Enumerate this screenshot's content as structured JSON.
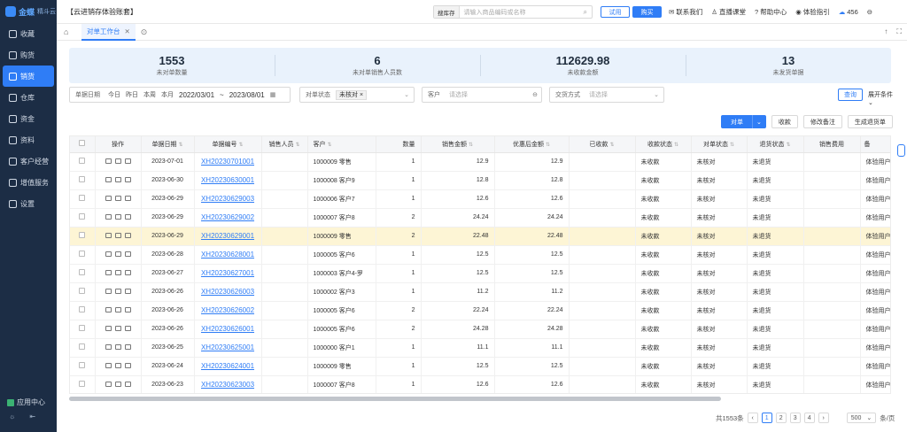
{
  "sidebar": {
    "logo": "金蝶",
    "logo_sub": "精斗云",
    "items": [
      {
        "label": "收藏"
      },
      {
        "label": "购货"
      },
      {
        "label": "销货"
      },
      {
        "label": "仓库"
      },
      {
        "label": "资金"
      },
      {
        "label": "资料"
      },
      {
        "label": "客户经营"
      },
      {
        "label": "增值服务"
      },
      {
        "label": "设置"
      }
    ],
    "app_center": "应用中心"
  },
  "topbar": {
    "company": "【云进销存体验账套】",
    "search_scope": "搜库存",
    "search_placeholder": "请输入商品编码或名称",
    "trial": "试用",
    "buy": "购买",
    "links": [
      "联系我们",
      "直播课堂",
      "帮助中心",
      "体验指引"
    ],
    "count": "456"
  },
  "tabs": {
    "active": "对单工作台"
  },
  "stats": [
    {
      "value": "1553",
      "label": "未对单数量"
    },
    {
      "value": "6",
      "label": "未对单销售人员数"
    },
    {
      "value": "112629.98",
      "label": "未收款金额"
    },
    {
      "value": "13",
      "label": "未发货单据"
    }
  ],
  "filters": {
    "date_label": "单据日期",
    "quick": [
      "今日",
      "昨日",
      "本周",
      "本月"
    ],
    "date_from": "2022/03/01",
    "date_sep": "~",
    "date_to": "2023/08/01",
    "status_label": "对单状态",
    "status_value": "未核对",
    "customer_label": "客户",
    "customer_ph": "请选择",
    "trade_label": "交货方式",
    "trade_ph": "请选择",
    "query": "查询",
    "expand": "展开条件"
  },
  "actions": {
    "check": "对单",
    "collect": "收款",
    "remark": "修改备注",
    "return": "生成退货单"
  },
  "table": {
    "headers": [
      "操作",
      "单据日期",
      "单据编号",
      "销售人员",
      "客户",
      "数量",
      "销售金额",
      "优惠后金额",
      "已收款",
      "收款状态",
      "对单状态",
      "退货状态",
      "销售费用",
      "备"
    ],
    "rows": [
      {
        "date": "2023-07-01",
        "no": "XH20230701001",
        "cust": "1000009 零售",
        "qty": "1",
        "amt": "12.9",
        "disc": "12.9",
        "recv": "未收款",
        "chk": "未核对",
        "ret": "未退货",
        "note": "体验用户"
      },
      {
        "date": "2023-06-30",
        "no": "XH20230630001",
        "cust": "1000008 客户9",
        "qty": "1",
        "amt": "12.8",
        "disc": "12.8",
        "recv": "未收款",
        "chk": "未核对",
        "ret": "未退货",
        "note": "体验用户"
      },
      {
        "date": "2023-06-29",
        "no": "XH20230629003",
        "cust": "1000006 客户7",
        "qty": "1",
        "amt": "12.6",
        "disc": "12.6",
        "recv": "未收款",
        "chk": "未核对",
        "ret": "未退货",
        "note": "体验用户"
      },
      {
        "date": "2023-06-29",
        "no": "XH20230629002",
        "cust": "1000007 客户8",
        "qty": "2",
        "amt": "24.24",
        "disc": "24.24",
        "recv": "未收款",
        "chk": "未核对",
        "ret": "未退货",
        "note": "体验用户"
      },
      {
        "date": "2023-06-29",
        "no": "XH20230629001",
        "cust": "1000009 零售",
        "qty": "2",
        "amt": "22.48",
        "disc": "22.48",
        "recv": "未收款",
        "chk": "未核对",
        "ret": "未退货",
        "note": "体验用户"
      },
      {
        "date": "2023-06-28",
        "no": "XH20230628001",
        "cust": "1000005 客户6",
        "qty": "1",
        "amt": "12.5",
        "disc": "12.5",
        "recv": "未收款",
        "chk": "未核对",
        "ret": "未退货",
        "note": "体验用户"
      },
      {
        "date": "2023-06-27",
        "no": "XH20230627001",
        "cust": "1000003 客户4-罗",
        "qty": "1",
        "amt": "12.5",
        "disc": "12.5",
        "recv": "未收款",
        "chk": "未核对",
        "ret": "未退货",
        "note": "体验用户"
      },
      {
        "date": "2023-06-26",
        "no": "XH20230626003",
        "cust": "1000002 客户3",
        "qty": "1",
        "amt": "11.2",
        "disc": "11.2",
        "recv": "未收款",
        "chk": "未核对",
        "ret": "未退货",
        "note": "体验用户"
      },
      {
        "date": "2023-06-26",
        "no": "XH20230626002",
        "cust": "1000005 客户6",
        "qty": "2",
        "amt": "22.24",
        "disc": "22.24",
        "recv": "未收款",
        "chk": "未核对",
        "ret": "未退货",
        "note": "体验用户"
      },
      {
        "date": "2023-06-26",
        "no": "XH20230626001",
        "cust": "1000005 客户6",
        "qty": "2",
        "amt": "24.28",
        "disc": "24.28",
        "recv": "未收款",
        "chk": "未核对",
        "ret": "未退货",
        "note": "体验用户"
      },
      {
        "date": "2023-06-25",
        "no": "XH20230625001",
        "cust": "1000000 客户1",
        "qty": "1",
        "amt": "11.1",
        "disc": "11.1",
        "recv": "未收款",
        "chk": "未核对",
        "ret": "未退货",
        "note": "体验用户"
      },
      {
        "date": "2023-06-24",
        "no": "XH20230624001",
        "cust": "1000009 零售",
        "qty": "1",
        "amt": "12.5",
        "disc": "12.5",
        "recv": "未收款",
        "chk": "未核对",
        "ret": "未退货",
        "note": "体验用户"
      },
      {
        "date": "2023-06-23",
        "no": "XH20230623003",
        "cust": "1000007 客户8",
        "qty": "1",
        "amt": "12.6",
        "disc": "12.6",
        "recv": "未收款",
        "chk": "未核对",
        "ret": "未退货",
        "note": "体验用户"
      }
    ],
    "highlight_row": 4
  },
  "pager": {
    "total": "共1553条",
    "pages": [
      "1",
      "2",
      "3",
      "4"
    ],
    "current": "1",
    "size": "500",
    "unit": "条/页"
  },
  "colors": {
    "primary": "#2f7df6",
    "sidebar": "#1c2d45",
    "highlight": "#fdf5d5"
  }
}
